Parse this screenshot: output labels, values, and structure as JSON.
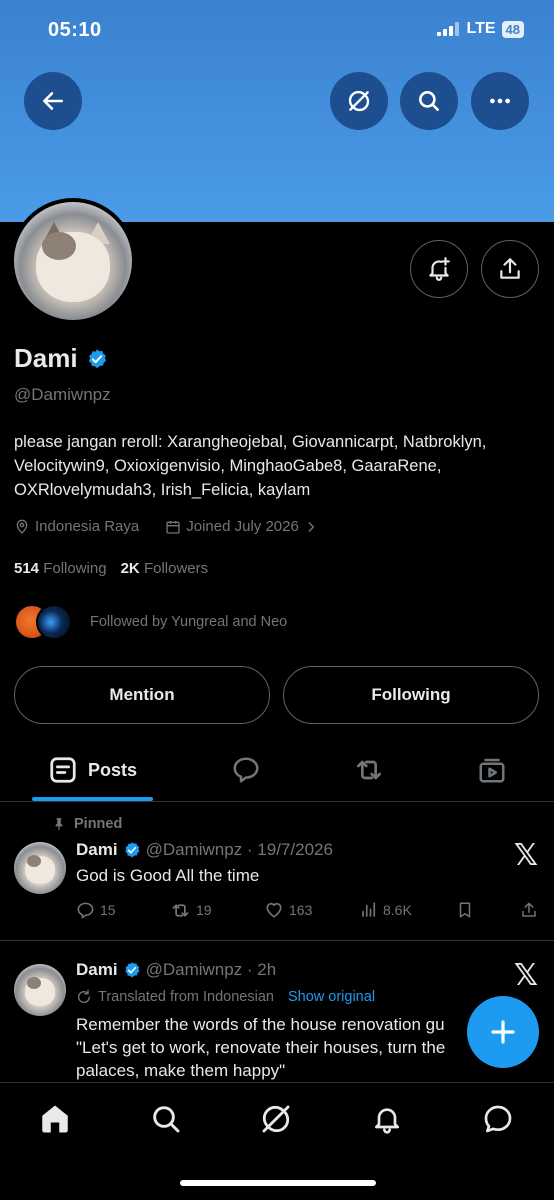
{
  "status_bar": {
    "time": "05:10",
    "network": "LTE",
    "battery": "48"
  },
  "header_buttons": {
    "back": "back-arrow",
    "grok": "grok-icon",
    "search": "search-icon",
    "more": "more-icon"
  },
  "profile": {
    "name": "Dami",
    "handle": "@Damiwnpz",
    "bio": "please jangan reroll: Xarangheojebal, Giovannicarpt, Natbroklyn, Velocitywin9, Oxioxigenvisio, MinghaoGabe8, GaaraRene, OXRlovelymudah3, Irish_Felicia, kaylam",
    "location": "Indonesia Raya",
    "joined": "Joined July 2026",
    "following_count": "514",
    "following_label": "Following",
    "followers_count": "2K",
    "followers_label": "Followers",
    "followed_by": "Followed by Yungreal and Neo"
  },
  "buttons": {
    "mention": "Mention",
    "following": "Following"
  },
  "tabs": {
    "posts": "Posts"
  },
  "posts": [
    {
      "pinned": "Pinned",
      "name": "Dami",
      "meta": "@Damiwnpz · 19/7/2026",
      "text": "God is Good All the time",
      "replies": "15",
      "reposts": "19",
      "likes": "163",
      "views": "8.6K"
    },
    {
      "name": "Dami",
      "meta": "@Damiwnpz · 2h",
      "translated": "Translated from Indonesian",
      "show_original": "Show original",
      "text_line1": "Remember the words of the house renovation gu",
      "text_line2": "\"Let's get to work, renovate their houses, turn the",
      "text_line3": "palaces, make them happy\""
    }
  ],
  "colors": {
    "accent": "#1d9bf0",
    "banner": "#4a9be8",
    "muted": "#71767b"
  }
}
